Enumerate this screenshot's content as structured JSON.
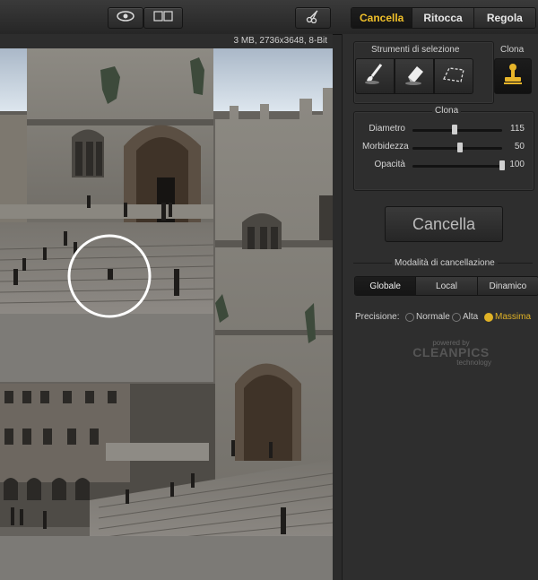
{
  "toolbar": {
    "view_toggle_icon": "eye-icon",
    "compare_icon": "split-view-icon",
    "scissors_icon": "scissors-icon",
    "modes": [
      {
        "label": "Cancella",
        "active": true
      },
      {
        "label": "Ritocca",
        "active": false
      },
      {
        "label": "Regola",
        "active": false
      }
    ]
  },
  "image_info": "3 MB, 2736x3648, 8-Bit",
  "panel": {
    "tools_title": "Strumenti di selezione",
    "clone_title": "Clona",
    "tools": [
      "brush-icon",
      "eraser-icon",
      "lasso-icon"
    ],
    "clone_tool": "stamp-icon",
    "clone_group_title": "Clona",
    "sliders": [
      {
        "label": "Diametro",
        "value": "115",
        "fraction": 0.5
      },
      {
        "label": "Morbidezza",
        "value": "50",
        "fraction": 0.55
      },
      {
        "label": "Opacità",
        "value": "100",
        "fraction": 1.0
      }
    ],
    "erase_button": "Cancella",
    "erase_mode_title": "Modalità di cancellazione",
    "erase_modes": [
      {
        "label": "Globale",
        "active": true
      },
      {
        "label": "Local",
        "active": false
      },
      {
        "label": "Dinamico",
        "active": false
      }
    ],
    "precision_label": "Precisione:",
    "precision_options": [
      {
        "label": "Normale",
        "selected": false
      },
      {
        "label": "Alta",
        "selected": false
      },
      {
        "label": "Massima",
        "selected": true
      }
    ],
    "logo": {
      "powered": "powered by",
      "brand": "CLEANPICS",
      "sub": "technology"
    }
  },
  "colors": {
    "accent": "#f0c02a",
    "panel": "#2e2e2e",
    "toolbar": "#333333"
  }
}
